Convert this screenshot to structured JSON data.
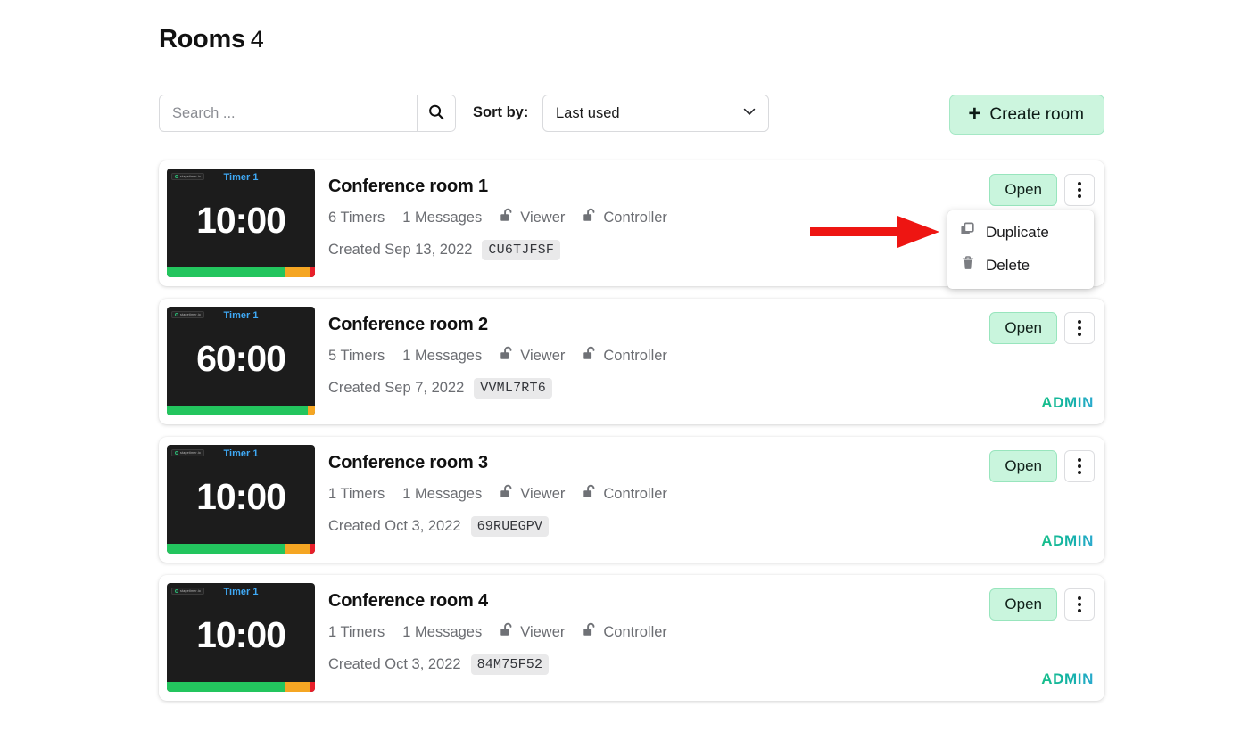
{
  "header": {
    "title": "Rooms",
    "count": "4"
  },
  "toolbar": {
    "search_placeholder": "Search ...",
    "search_value": "",
    "search_icon": "search-icon",
    "sort_label": "Sort by:",
    "sort_value": "Last used",
    "sort_chevron_icon": "chevron-down-icon",
    "create_plus": "+",
    "create_label": "Create room"
  },
  "actions": {
    "open_label": "Open",
    "kebab_icon": "kebab-menu-icon"
  },
  "dropdown": {
    "items": [
      {
        "label": "Duplicate",
        "icon": "duplicate-icon"
      },
      {
        "label": "Delete",
        "icon": "trash-icon"
      }
    ]
  },
  "annotation": {
    "arrow_color": "#ee1512",
    "arrow_points_to": "Duplicate"
  },
  "colors": {
    "accent_green": "#c9f5dd",
    "accent_green_border": "#98e5bd",
    "bar_green": "#23c55e",
    "bar_orange": "#f5a623",
    "bar_red": "#e8202a",
    "timer_name_blue": "#3fa9f5",
    "admin_gradient_start": "#18bf8a",
    "admin_gradient_end": "#2aa9cf"
  },
  "rooms": [
    {
      "name": "Conference room 1",
      "timers": "6 Timers",
      "messages": "1 Messages",
      "viewer": "Viewer",
      "controller": "Controller",
      "created": "Created Sep 13, 2022",
      "code": "CU6TJFSF",
      "admin": "",
      "thumb": {
        "logo": "stagetimer.io",
        "timer_name": "Timer 1",
        "time": "10:00",
        "bar_green_pct": 80,
        "bar_orange_pct": 17,
        "bar_red_pct": 3
      }
    },
    {
      "name": "Conference room 2",
      "timers": "5 Timers",
      "messages": "1 Messages",
      "viewer": "Viewer",
      "controller": "Controller",
      "created": "Created Sep 7, 2022",
      "code": "VVML7RT6",
      "admin": "ADMIN",
      "thumb": {
        "logo": "stagetimer.io",
        "timer_name": "Timer 1",
        "time": "60:00",
        "bar_green_pct": 95,
        "bar_orange_pct": 5,
        "bar_red_pct": 0
      }
    },
    {
      "name": "Conference room 3",
      "timers": "1 Timers",
      "messages": "1 Messages",
      "viewer": "Viewer",
      "controller": "Controller",
      "created": "Created Oct 3, 2022",
      "code": "69RUEGPV",
      "admin": "ADMIN",
      "thumb": {
        "logo": "stagetimer.io",
        "timer_name": "Timer 1",
        "time": "10:00",
        "bar_green_pct": 80,
        "bar_orange_pct": 17,
        "bar_red_pct": 3
      }
    },
    {
      "name": "Conference room 4",
      "timers": "1 Timers",
      "messages": "1 Messages",
      "viewer": "Viewer",
      "controller": "Controller",
      "created": "Created Oct 3, 2022",
      "code": "84M75F52",
      "admin": "ADMIN",
      "thumb": {
        "logo": "stagetimer.io",
        "timer_name": "Timer 1",
        "time": "10:00",
        "bar_green_pct": 80,
        "bar_orange_pct": 17,
        "bar_red_pct": 3
      }
    }
  ]
}
